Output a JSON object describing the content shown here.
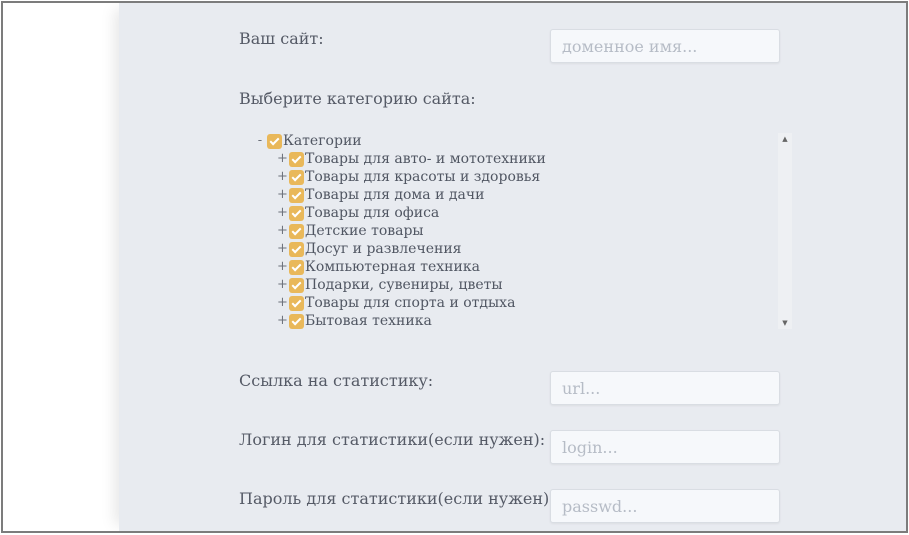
{
  "form": {
    "site_label": "Ваш сайт:",
    "site_placeholder": "доменное имя...",
    "category_label": "Выберите категорию сайта:",
    "stats_url_label": "Ссылка на статистику:",
    "stats_url_placeholder": "url...",
    "stats_login_label": "Логин для статистики(если нужен):",
    "stats_login_placeholder": "login...",
    "stats_password_label": "Пароль для статистики(если нужен):",
    "stats_password_placeholder": "passwd..."
  },
  "tree": {
    "root": {
      "toggle": "-",
      "label": "Категории",
      "checked": true
    },
    "items": [
      {
        "toggle": "+",
        "label": "Товары для авто- и мототехники",
        "checked": true
      },
      {
        "toggle": "+",
        "label": "Товары для красоты и здоровья",
        "checked": true
      },
      {
        "toggle": "+",
        "label": "Товары для дома и дачи",
        "checked": true
      },
      {
        "toggle": "+",
        "label": "Товары для офиса",
        "checked": true
      },
      {
        "toggle": "+",
        "label": "Детские товары",
        "checked": true
      },
      {
        "toggle": "+",
        "label": "Досуг и развлечения",
        "checked": true
      },
      {
        "toggle": "+",
        "label": "Компьютерная техника",
        "checked": true
      },
      {
        "toggle": "+",
        "label": "Подарки, сувениры, цветы",
        "checked": true
      },
      {
        "toggle": "+",
        "label": "Товары для спорта и отдыха",
        "checked": true
      },
      {
        "toggle": "+",
        "label": "Бытовая техника",
        "checked": true
      }
    ]
  },
  "scrollbar": {
    "up_arrow": "▲",
    "down_arrow": "▼"
  },
  "colors": {
    "checkbox": "#e9b85a",
    "panel_background": "#e8ebf0",
    "frame_border": "#7c7c7c"
  }
}
